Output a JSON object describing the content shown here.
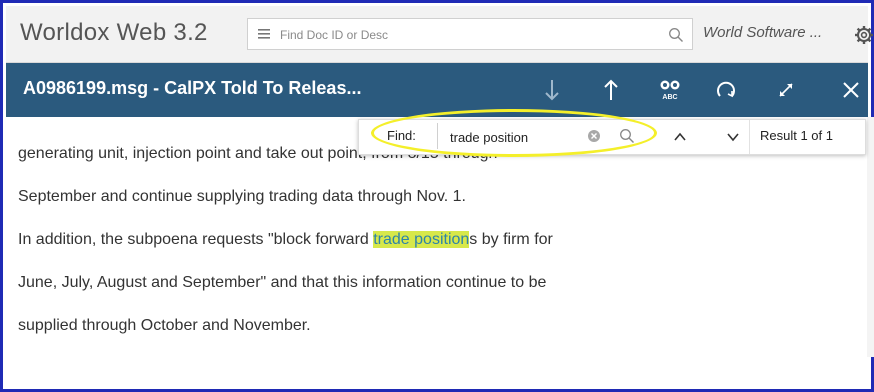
{
  "app": {
    "title": "Worldox Web 3.2",
    "search_placeholder": "Find Doc ID or Desc",
    "org_name": "World Software ..."
  },
  "document": {
    "title": "A0986199.msg - CalPX Told To Releas...",
    "lines": [
      "generating unit, injection point and take out point, from 8/15 through",
      "September and continue supplying trading data through Nov. 1.",
      {
        "before": "In addition, the subpoena requests \"block forward ",
        "match": "trade position",
        "after": "s by firm for"
      },
      "June, July, August and September\" and that this information continue to be",
      "supplied through October and November."
    ]
  },
  "toolbar": {
    "icons": [
      "download-icon",
      "upload-icon",
      "spellcheck-icon",
      "refresh-icon",
      "expand-icon",
      "close-icon"
    ]
  },
  "find": {
    "label": "Find:",
    "value": "trade position",
    "result": "Result 1 of 1"
  },
  "colors": {
    "frame": "#1f2ab5",
    "doc_bar": "#2b5a7e",
    "highlight_bg": "#d7e84a",
    "highlight_text": "#2e83a8",
    "annotation_ring": "#f4ef2a"
  }
}
